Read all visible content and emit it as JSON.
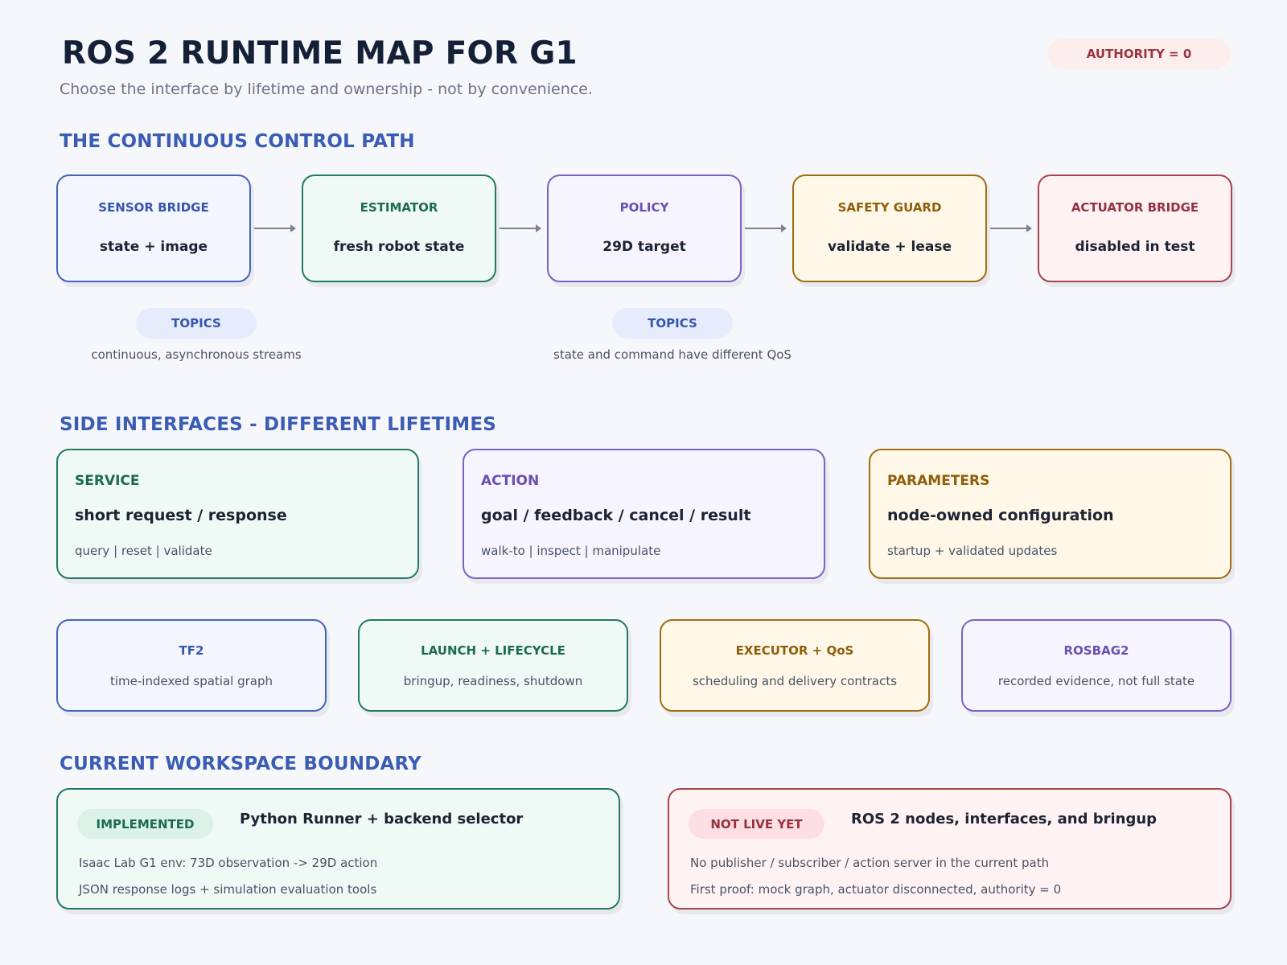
{
  "header": {
    "title": "ROS 2 RUNTIME MAP FOR G1",
    "subtitle": "Choose the interface by lifetime and ownership - not by convenience.",
    "authority_badge": "AUTHORITY = 0"
  },
  "sections": {
    "control_path": "THE CONTINUOUS CONTROL PATH",
    "side_interfaces": "SIDE INTERFACES - DIFFERENT LIFETIMES",
    "workspace_boundary": "CURRENT WORKSPACE BOUNDARY"
  },
  "pipeline": [
    {
      "label": "SENSOR BRIDGE",
      "value": "state + image"
    },
    {
      "label": "ESTIMATOR",
      "value": "fresh robot state"
    },
    {
      "label": "POLICY",
      "value": "29D target"
    },
    {
      "label": "SAFETY GUARD",
      "value": "validate + lease"
    },
    {
      "label": "ACTUATOR BRIDGE",
      "value": "disabled in test"
    }
  ],
  "topics": [
    {
      "label": "TOPICS",
      "note": "continuous, asynchronous streams"
    },
    {
      "label": "TOPICS",
      "note": "state and command have different QoS"
    }
  ],
  "side_interfaces": [
    {
      "label": "SERVICE",
      "head": "short request / response",
      "desc": "query | reset | validate"
    },
    {
      "label": "ACTION",
      "head": "goal / feedback / cancel / result",
      "desc": "walk-to | inspect | manipulate"
    },
    {
      "label": "PARAMETERS",
      "head": "node-owned configuration",
      "desc": "startup + validated updates"
    }
  ],
  "tools": [
    {
      "label": "TF2",
      "desc": "time-indexed spatial graph"
    },
    {
      "label": "LAUNCH + LIFECYCLE",
      "desc": "bringup, readiness, shutdown"
    },
    {
      "label": "EXECUTOR + QoS",
      "desc": "scheduling and delivery contracts"
    },
    {
      "label": "ROSBAG2",
      "desc": "recorded evidence, not full state"
    }
  ],
  "boundary": {
    "implemented": {
      "tag": "IMPLEMENTED",
      "head": "Python Runner + backend selector",
      "lines": [
        "Isaac Lab G1 env: 73D observation -> 29D action",
        "JSON response logs + simulation evaluation tools"
      ]
    },
    "not_live": {
      "tag": "NOT LIVE YET",
      "head": "ROS 2 nodes, interfaces, and bringup",
      "lines": [
        "No publisher / subscriber / action server in the current path",
        "First proof: mock graph, actuator disconnected, authority = 0"
      ]
    }
  },
  "colors": {
    "blue": "#4763b8",
    "green": "#247a5e",
    "purple": "#7b62c0",
    "amber": "#a06d12",
    "red": "#a8434f",
    "section_title": "#3a5cb4"
  }
}
